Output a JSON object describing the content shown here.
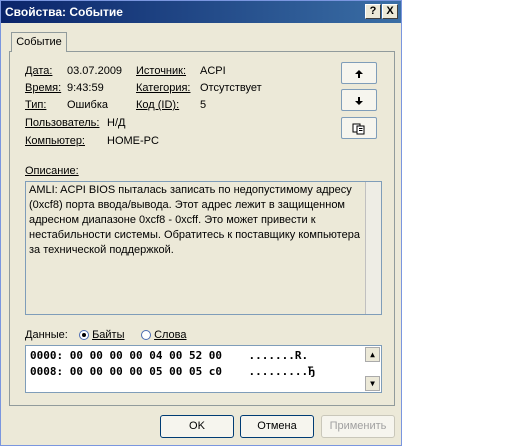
{
  "window": {
    "title": "Свойства: Событие"
  },
  "titlebar": {
    "help": "?",
    "close": "X"
  },
  "tab": {
    "label": "Событие"
  },
  "fields": {
    "date_label": "Дата:",
    "date_value": "03.07.2009",
    "source_label": "Источник:",
    "source_value": "ACPI",
    "time_label": "Время:",
    "time_value": "9:43:59",
    "category_label": "Категория:",
    "category_value": "Отсутствует",
    "type_label": "Тип:",
    "type_value": "Ошибка",
    "code_label": "Код (ID):",
    "code_value": "5",
    "user_label": "Пользователь:",
    "user_value": "Н/Д",
    "computer_label": "Компьютер:",
    "computer_value": "HOME-PC"
  },
  "nav": {
    "up_icon": "arrow-up-icon",
    "down_icon": "arrow-down-icon",
    "copy_icon": "copy-icon"
  },
  "description": {
    "label": "Описание:",
    "text": "AMLI: ACPI BIOS пыталась записать по недопустимому адресу (0xcf8) порта ввода/вывода. Этот адрес лежит в защищенном адресном диапазоне 0xcf8 - 0xcff.  Это может привести к нестабильности системы. Обратитесь к поставщику компьютера за технической поддержкой."
  },
  "data_section": {
    "label": "Данные:",
    "bytes_label": "Байты",
    "words_label": "Слова",
    "selected": "Байты",
    "lines": [
      "0000: 00 00 00 00 04 00 52 00    .......R.",
      "0008: 00 00 00 00 05 00 05 c0    .........Ђ"
    ]
  },
  "buttons": {
    "ok": "OK",
    "cancel": "Отмена",
    "apply": "Применить"
  }
}
